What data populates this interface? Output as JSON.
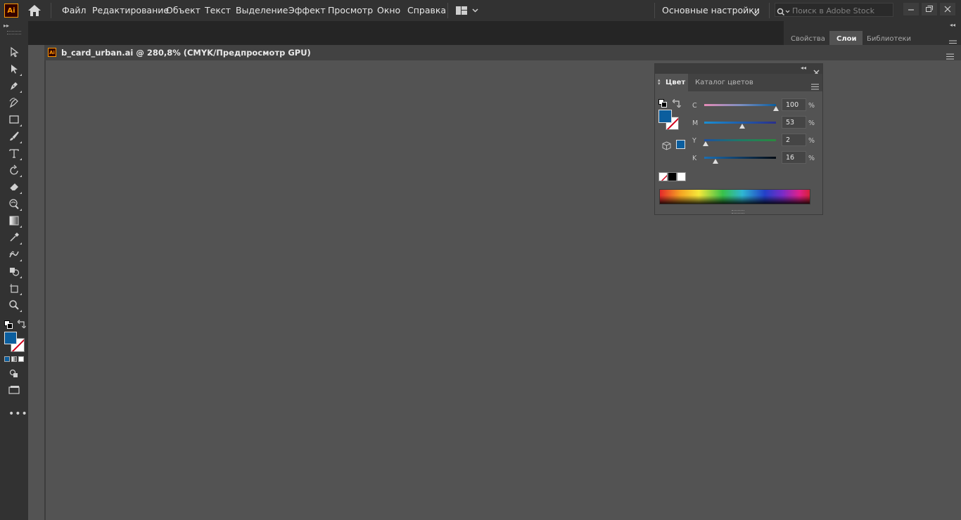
{
  "app": {
    "logo": "Ai",
    "menu": [
      "Файл",
      "Редактирование",
      "Объект",
      "Текст",
      "Выделение",
      "Эффект",
      "Просмотр",
      "Окно",
      "Справка"
    ],
    "workspace": "Основные настройки",
    "search_placeholder": "Поиск в Adobe Stock"
  },
  "right_panel_tabs": [
    "Свойства",
    "Слои",
    "Библиотеки"
  ],
  "active_right_tab": "Слои",
  "document": {
    "title": "b_card_urban.ai @ 280,8% (CMYK/Предпросмотр GPU)"
  },
  "tools": [
    "selection-icon",
    "direct-selection-icon",
    "pen-icon",
    "curvature-icon",
    "rectangle-icon",
    "paintbrush-icon",
    "type-icon",
    "rotate-icon",
    "eraser-icon",
    "warp-icon",
    "gradient-icon",
    "eyedropper-icon",
    "blend-icon",
    "shape-builder-icon",
    "artboard-icon",
    "zoom-icon"
  ],
  "colors": {
    "fill": "#0b5e9e",
    "accent_orange": "#ff9a00"
  },
  "color_panel": {
    "tabs": [
      "Цвет",
      "Каталог цветов"
    ],
    "sliders": [
      {
        "label": "C",
        "value": "100",
        "unit": "%"
      },
      {
        "label": "M",
        "value": "53",
        "unit": "%"
      },
      {
        "label": "Y",
        "value": "2",
        "unit": "%"
      },
      {
        "label": "K",
        "value": "16",
        "unit": "%"
      }
    ]
  }
}
